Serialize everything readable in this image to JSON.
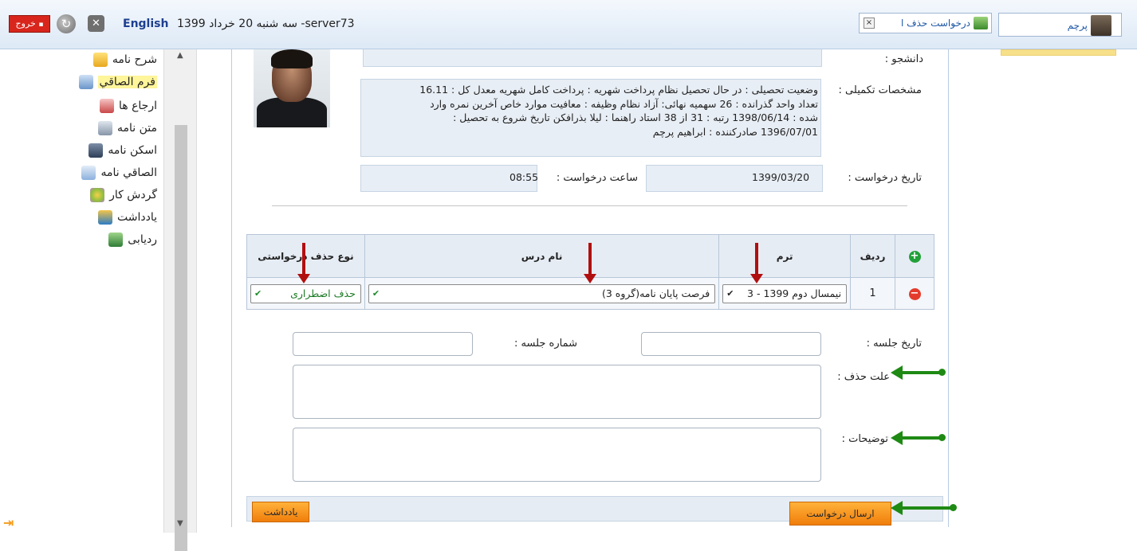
{
  "topbar": {
    "exit_label": "خروج",
    "lang_label": "English",
    "server_date": "سه شنبه 20 خرداد 1399 -server73",
    "open_tab_label": "درخواست حذف ا",
    "open_tab_close": "×",
    "user_name": "پرچم"
  },
  "sidebar": {
    "items": [
      {
        "label": "شرح نامه",
        "icon": "envelope-icon"
      },
      {
        "label": "فرم الصاقي",
        "icon": "form-icon"
      },
      {
        "label": "ارجاع ها",
        "icon": "refer-icon"
      },
      {
        "label": "متن نامه",
        "icon": "text-icon"
      },
      {
        "label": "اسکن نامه",
        "icon": "scan-icon"
      },
      {
        "label": "الصاقي نامه",
        "icon": "attach-icon"
      },
      {
        "label": "گردش کار",
        "icon": "workflow-icon"
      },
      {
        "label": "يادداشت",
        "icon": "note-icon"
      },
      {
        "label": "ردیابی",
        "icon": "track-icon"
      }
    ]
  },
  "form": {
    "student_label": "دانشجو :",
    "details_label": "مشخصات تکمیلی :",
    "details_lines": [
      "وضعیت تحصیلی : در حال تحصیل   نظام پرداخت شهریه : پرداخت کامل شهریه   معدل کل : 16.11",
      "تعداد واحد گذرانده : 26   سهمیه نهائی: آزاد   نظام وظیفه : معافیت موارد خاص   آخرین نمره وارد",
      "شده : 1398/06/14   رتبه : 31 از 38   استاد راهنما : لیلا بذرافکن   تاریخ شروع به تحصیل :",
      "1396/07/01   صادرکننده : ابراهیم پرچم"
    ],
    "request_date_label": "تاریخ درخواست :",
    "request_date_value": "1399/03/20",
    "request_time_label": "ساعت درخواست :",
    "request_time_value": "08:55",
    "session_date_label": "تاریخ جلسه :",
    "session_number_label": "شماره جلسه :",
    "delete_reason_label": "علت حذف :",
    "description_label": "توضیحات :"
  },
  "table": {
    "headers": {
      "row": "ردیف",
      "term": "ترم",
      "course": "نام درس",
      "type": "نوع حذف درخواستی"
    },
    "rows": [
      {
        "row": "1",
        "term": "نیمسال دوم 1399 - 3",
        "course": "فرصت پایان نامه(گروه 3)",
        "type": "حذف اضطراری"
      }
    ]
  },
  "footer": {
    "send_label": "ارسال درخواست",
    "note_label": "یادداشت"
  },
  "colors": {
    "accent": "#f07d0a",
    "header_bg": "#e6ecf4",
    "green": "#1e8a14",
    "red": "#b10f0f",
    "exit": "#d8261c"
  }
}
